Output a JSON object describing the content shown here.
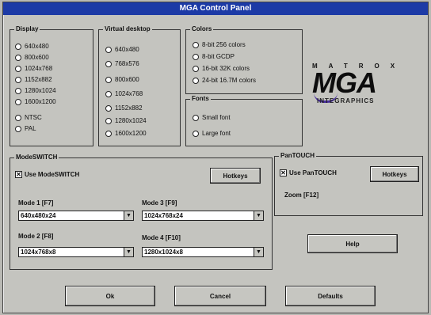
{
  "window": {
    "title": "MGA Control Panel"
  },
  "display": {
    "title": "Display",
    "options": [
      "640x480",
      "800x600",
      "1024x768",
      "1152x882",
      "1280x1024",
      "1600x1200",
      "NTSC",
      "PAL"
    ]
  },
  "virtual_desktop": {
    "title": "Virtual desktop",
    "options": [
      "640x480",
      "768x576",
      "800x600",
      "1024x768",
      "1152x882",
      "1280x1024",
      "1600x1200"
    ]
  },
  "colors": {
    "title": "Colors",
    "options": [
      "8-bit 256 colors",
      "8-bit GCDP",
      "16-bit 32K colors",
      "24-bit 16.7M colors"
    ]
  },
  "fonts": {
    "title": "Fonts",
    "options": [
      "Small font",
      "Large font"
    ]
  },
  "logo": {
    "brand": "MATROX",
    "product": "MGA",
    "subtitle": "INTEGRAPHICS"
  },
  "modeswitch": {
    "title": "ModeSWITCH",
    "use_label": "Use ModeSWITCH",
    "hotkeys_label": "Hotkeys",
    "modes": [
      {
        "label": "Mode 1 [F7]",
        "value": "640x480x24"
      },
      {
        "label": "Mode 3 [F9]",
        "value": "1024x768x24"
      },
      {
        "label": "Mode 2 [F8]",
        "value": "1024x768x8"
      },
      {
        "label": "Mode 4 [F10]",
        "value": "1280x1024x8"
      }
    ]
  },
  "pantouch": {
    "title": "PanTOUCH",
    "use_label": "Use PanTOUCH",
    "hotkeys_label": "Hotkeys",
    "zoom_label": "Zoom [F12]"
  },
  "buttons": {
    "help": "Help",
    "ok": "Ok",
    "cancel": "Cancel",
    "defaults": "Defaults"
  }
}
